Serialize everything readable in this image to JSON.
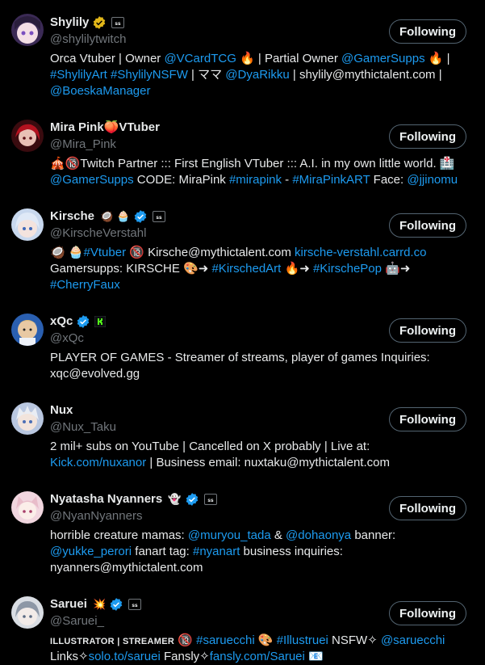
{
  "follow_label": "Following",
  "accent_color": "#1d9bf0",
  "users": [
    {
      "name": "Shylily",
      "handle": "@shylilytwitch",
      "name_badges": [
        "gold-verified-icon",
        "affiliate-icon"
      ],
      "bio_lines": [
        [
          {
            "t": "Orca Vtuber | Owner ",
            "link": false
          },
          {
            "t": "@VCardTCG",
            "link": true
          },
          {
            "t": " 🔥 | Partial Owner ",
            "link": false
          },
          {
            "t": "@GamerSupps",
            "link": true
          },
          {
            "t": " 🔥 |",
            "link": false
          }
        ],
        [
          {
            "t": "#ShylilyArt",
            "link": true
          },
          {
            "t": " ",
            "link": false
          },
          {
            "t": "#ShylilyNSFW",
            "link": true
          },
          {
            "t": " | ママ ",
            "link": false
          },
          {
            "t": "@DyaRikku",
            "link": true
          },
          {
            "t": " | shylily@mythictalent.com |",
            "link": false
          }
        ],
        [
          {
            "t": "@BoeskaManager",
            "link": true
          }
        ]
      ]
    },
    {
      "name": "Mira Pink",
      "name_suffix": "🍑VTuber",
      "handle": "@Mira_Pink",
      "name_badges": [],
      "bio_lines": [
        [
          {
            "t": "🎪🔞Twitch Partner ::: First English VTuber ::: A.I. in my own little world. 🏥",
            "link": false
          }
        ],
        [
          {
            "t": "@GamerSupps",
            "link": true
          },
          {
            "t": " CODE: MiraPink ",
            "link": false
          },
          {
            "t": "#mirapink",
            "link": true
          },
          {
            "t": " - ",
            "link": false
          },
          {
            "t": "#MiraPinkART",
            "link": true
          },
          {
            "t": " Face: ",
            "link": false
          },
          {
            "t": "@jjinomu",
            "link": true
          }
        ]
      ]
    },
    {
      "name": "Kirsche",
      "name_suffix": "🥥 🧁",
      "handle": "@KirscheVerstahl",
      "name_badges": [
        "blue-verified-icon",
        "affiliate-icon"
      ],
      "bio_lines": [
        [
          {
            "t": "🥥 🧁",
            "link": false
          },
          {
            "t": "#Vtuber",
            "link": true
          },
          {
            "t": " 🔞 Kirsche@mythictalent.com ",
            "link": false
          },
          {
            "t": "kirsche-verstahl.carrd.co",
            "link": true
          }
        ],
        [
          {
            "t": "Gamersupps: KIRSCHE 🎨➜ ",
            "link": false
          },
          {
            "t": "#KirschedArt",
            "link": true
          },
          {
            "t": " 🔥➜ ",
            "link": false
          },
          {
            "t": "#KirschePop",
            "link": true
          },
          {
            "t": " 🤖➜",
            "link": false
          }
        ],
        [
          {
            "t": "#CherryFaux",
            "link": true
          }
        ]
      ]
    },
    {
      "name": "xQc",
      "handle": "@xQc",
      "name_badges": [
        "blue-verified-icon",
        "kick-icon"
      ],
      "bio_lines": [
        [
          {
            "t": "PLAYER OF GAMES - Streamer of streams, player of games Inquiries:",
            "link": false
          }
        ],
        [
          {
            "t": "xqc@evolved.gg",
            "link": false
          }
        ]
      ]
    },
    {
      "name": "Nux",
      "handle": "@Nux_Taku",
      "name_badges": [],
      "bio_lines": [
        [
          {
            "t": "2 mil+ subs on YouTube | Cancelled on X probably | Live at:",
            "link": false
          }
        ],
        [
          {
            "t": "Kick.com/nuxanor",
            "link": true
          },
          {
            "t": " | Business email: nuxtaku@mythictalent.com",
            "link": false
          }
        ]
      ]
    },
    {
      "name": "Nyatasha Nyanners",
      "name_suffix": "👻",
      "handle": "@NyanNyanners",
      "name_badges": [
        "blue-verified-icon",
        "affiliate-icon"
      ],
      "bio_lines": [
        [
          {
            "t": "horrible creature mamas: ",
            "link": false
          },
          {
            "t": "@muryou_tada",
            "link": true
          },
          {
            "t": " & ",
            "link": false
          },
          {
            "t": "@dohaonya",
            "link": true
          },
          {
            "t": " banner:",
            "link": false
          }
        ],
        [
          {
            "t": "@yukke_perori",
            "link": true
          },
          {
            "t": " fanart tag: ",
            "link": false
          },
          {
            "t": "#nyanart",
            "link": true
          },
          {
            "t": " business inquiries:",
            "link": false
          }
        ],
        [
          {
            "t": "nyanners@mythictalent.com",
            "link": false
          }
        ]
      ]
    },
    {
      "name": "Saruei",
      "name_suffix": "💥",
      "handle": "@Saruei_",
      "name_badges": [
        "blue-verified-icon",
        "affiliate-icon"
      ],
      "bio_lines": [
        [
          {
            "t": "ILLUSTRATOR | STREAMER",
            "link": false,
            "small": true
          },
          {
            "t": " 🔞 ",
            "link": false
          },
          {
            "t": "#saruecchi",
            "link": true
          },
          {
            "t": " 🎨 ",
            "link": false
          },
          {
            "t": "#Illustruei",
            "link": true
          },
          {
            "t": " NSFW✧ ",
            "link": false
          },
          {
            "t": "@saruecchi",
            "link": true
          }
        ],
        [
          {
            "t": "Links✧",
            "link": false
          },
          {
            "t": "solo.to/saruei",
            "link": true
          },
          {
            "t": " Fansly✧",
            "link": false
          },
          {
            "t": "fansly.com/Saruei",
            "link": true
          },
          {
            "t": " 📧",
            "link": false
          }
        ]
      ]
    }
  ]
}
